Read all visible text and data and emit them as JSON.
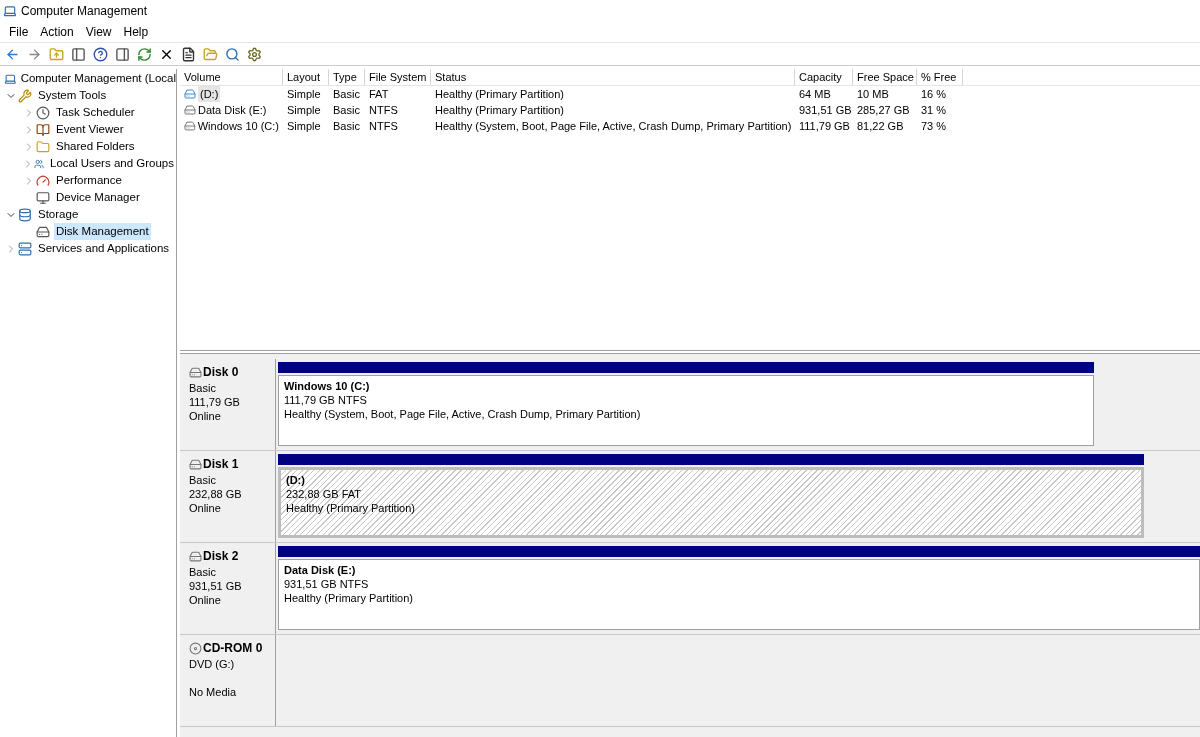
{
  "window": {
    "title": "Computer Management"
  },
  "menu": [
    "File",
    "Action",
    "View",
    "Help"
  ],
  "tree": {
    "label": "Computer Management (Local",
    "children": [
      {
        "label": "System Tools",
        "kind": "tools",
        "expanded": true,
        "selected": false,
        "children": [
          {
            "label": "Task Scheduler",
            "kind": "clock",
            "expanded": false,
            "selected": false
          },
          {
            "label": "Event Viewer",
            "kind": "log",
            "expanded": false,
            "selected": false
          },
          {
            "label": "Shared Folders",
            "kind": "folder",
            "expanded": false,
            "selected": false
          },
          {
            "label": "Local Users and Groups",
            "kind": "users",
            "expanded": false,
            "selected": false
          },
          {
            "label": "Performance",
            "kind": "gauge",
            "expanded": false,
            "selected": false
          },
          {
            "label": "Device Manager",
            "kind": "device",
            "selected": false
          }
        ]
      },
      {
        "label": "Storage",
        "kind": "storage",
        "expanded": true,
        "selected": false,
        "children": [
          {
            "label": "Disk Management",
            "kind": "disk",
            "selected": true
          }
        ]
      },
      {
        "label": "Services and Applications",
        "kind": "services",
        "expanded": false,
        "selected": false
      }
    ]
  },
  "volumes": {
    "columns": [
      "Volume",
      "Layout",
      "Type",
      "File System",
      "Status",
      "Capacity",
      "Free Space",
      "% Free"
    ],
    "rows": [
      {
        "selected": true,
        "kind": "removable",
        "cells": [
          "(D:)",
          "Simple",
          "Basic",
          "FAT",
          "Healthy (Primary Partition)",
          "64 MB",
          "10 MB",
          "16 %"
        ]
      },
      {
        "selected": false,
        "kind": "fixed",
        "cells": [
          "Data Disk (E:)",
          "Simple",
          "Basic",
          "NTFS",
          "Healthy (Primary Partition)",
          "931,51 GB",
          "285,27 GB",
          "31 %"
        ]
      },
      {
        "selected": false,
        "kind": "fixed",
        "cells": [
          "Windows 10 (C:)",
          "Simple",
          "Basic",
          "NTFS",
          "Healthy (System, Boot, Page File, Active, Crash Dump, Primary Partition)",
          "111,79 GB",
          "81,22 GB",
          "73 %"
        ]
      }
    ]
  },
  "disks": [
    {
      "kind": "disk",
      "name": "Disk 0",
      "lines": [
        "Basic",
        "111,79 GB",
        "Online"
      ],
      "partition": {
        "name": "Windows 10  (C:)",
        "size": "111,79 GB NTFS",
        "status": "Healthy (System, Boot, Page File, Active, Crash Dump, Primary Partition)",
        "selected": false
      }
    },
    {
      "kind": "disk",
      "name": "Disk 1",
      "lines": [
        "Basic",
        "232,88 GB",
        "Online"
      ],
      "partition": {
        "name": "(D:)",
        "size": "232,88 GB FAT",
        "status": "Healthy (Primary Partition)",
        "selected": true
      }
    },
    {
      "kind": "disk",
      "name": "Disk 2",
      "lines": [
        "Basic",
        "931,51 GB",
        "Online"
      ],
      "partition": {
        "name": "Data Disk  (E:)",
        "size": "931,51 GB NTFS",
        "status": "Healthy (Primary Partition)",
        "selected": false
      }
    },
    {
      "kind": "cdrom",
      "name": "CD-ROM 0",
      "lines": [
        "DVD (G:)",
        "No Media"
      ]
    }
  ]
}
